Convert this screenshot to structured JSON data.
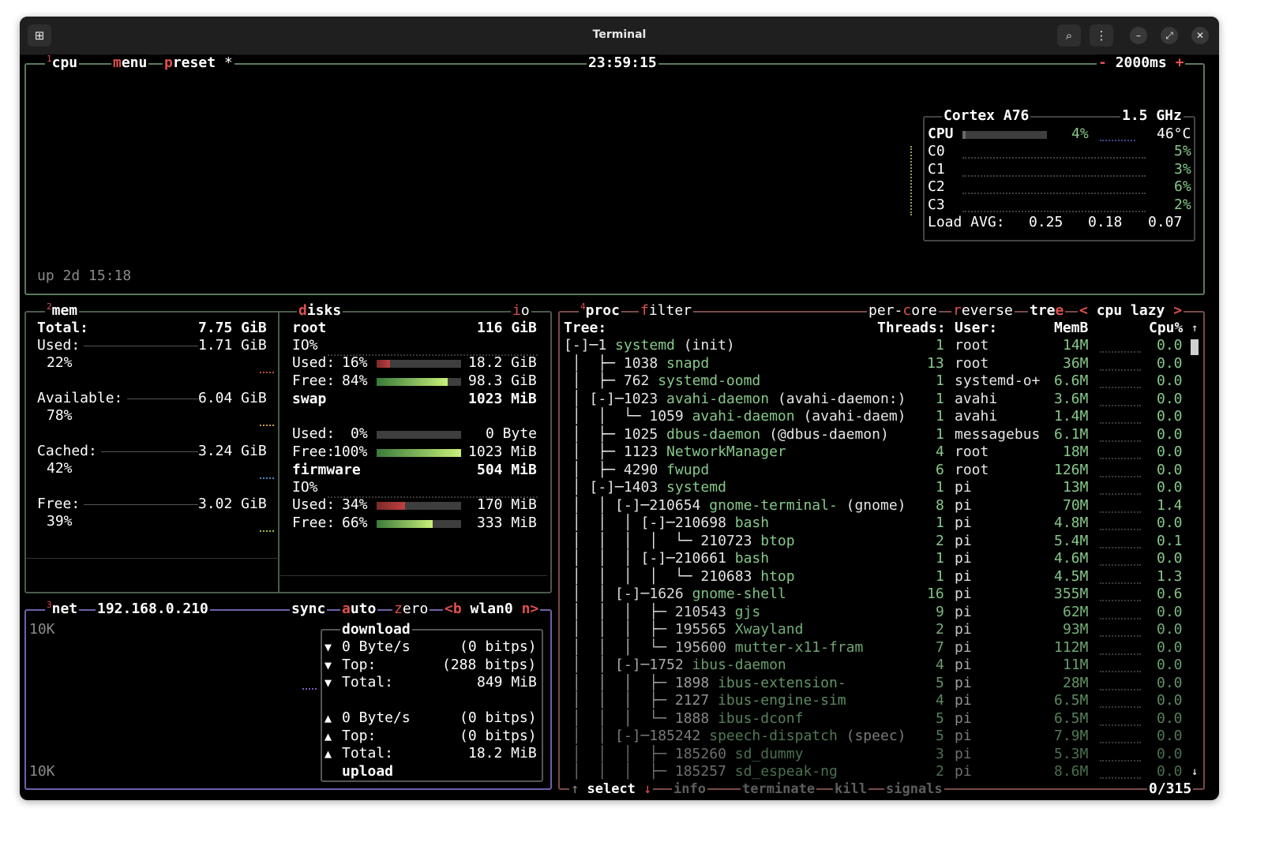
{
  "window": {
    "title": "Terminal"
  },
  "cpu": {
    "num": "1",
    "label": "cpu",
    "menu": "menu",
    "preset": "preset",
    "preset_star": "*",
    "clock": "23:59:15",
    "interval_minus": "-",
    "interval": "2000ms",
    "interval_plus": "+",
    "model": "Cortex A76",
    "freq": "1.5 GHz",
    "total_label": "CPU",
    "total_pct": "4%",
    "temp": "46°C",
    "total_fill": 0.04,
    "cores": [
      {
        "name": "C0",
        "pct": "5%"
      },
      {
        "name": "C1",
        "pct": "3%"
      },
      {
        "name": "C2",
        "pct": "6%"
      },
      {
        "name": "C3",
        "pct": "2%"
      }
    ],
    "load_label": "Load AVG:",
    "load": [
      "0.25",
      "0.18",
      "0.07"
    ],
    "uptime": "up 2d 15:18"
  },
  "mem": {
    "num": "2",
    "label": "mem",
    "total_label": "Total:",
    "total": "7.75 GiB",
    "rows": [
      {
        "label": "Used:",
        "value": "1.71 GiB",
        "pct": "22%"
      },
      {
        "label": "Available:",
        "value": "6.04 GiB",
        "pct": "78%"
      },
      {
        "label": "Cached:",
        "value": "3.24 GiB",
        "pct": "42%"
      },
      {
        "label": "Free:",
        "value": "3.02 GiB",
        "pct": "39%"
      }
    ]
  },
  "disks": {
    "label": "disks",
    "io": "io",
    "items": [
      {
        "name": "root",
        "size": "116 GiB",
        "io": "IO%",
        "used_label": "Used:",
        "used_pct": "16%",
        "used": "18.2 GiB",
        "used_fill": 0.16,
        "free_label": "Free:",
        "free_pct": "84%",
        "free": "98.3 GiB",
        "free_fill": 0.84
      },
      {
        "name": "swap",
        "size": "1023 MiB",
        "io": "",
        "used_label": "Used:",
        "used_pct": "0%",
        "used": "0 Byte",
        "used_fill": 0.0,
        "free_label": "Free:",
        "free_pct": "100%",
        "free": "1023 MiB",
        "free_fill": 1.0
      },
      {
        "name": "firmware",
        "size": "504 MiB",
        "io": "IO%",
        "used_label": "Used:",
        "used_pct": "34%",
        "used": "170 MiB",
        "used_fill": 0.34,
        "free_label": "Free:",
        "free_pct": "66%",
        "free": "333 MiB",
        "free_fill": 0.66
      }
    ]
  },
  "net": {
    "num": "3",
    "label": "net",
    "ip": "192.168.0.210",
    "sync": "sync",
    "auto": "auto",
    "zero": "zero",
    "prev": "<b",
    "iface": "wlan0",
    "next": "n>",
    "scale_top": "10K",
    "scale_bottom": "10K",
    "download_label": "download",
    "upload_label": "upload",
    "down": [
      {
        "icon": "▼",
        "label": "0 Byte/s",
        "value": "(0 bitps)"
      },
      {
        "icon": "▼",
        "label": "Top:",
        "value": "(288 bitps)"
      },
      {
        "icon": "▼",
        "label": "Total:",
        "value": "849 MiB"
      }
    ],
    "up": [
      {
        "icon": "▲",
        "label": "0 Byte/s",
        "value": "(0 bitps)"
      },
      {
        "icon": "▲",
        "label": "Top:",
        "value": "(0 bitps)"
      },
      {
        "icon": "▲",
        "label": "Total:",
        "value": "18.2 MiB"
      }
    ]
  },
  "proc": {
    "num": "4",
    "label": "proc",
    "filter": "filter",
    "per_core": "per-core",
    "reverse": "reverse",
    "tree": "tree",
    "sort_prev": "<",
    "sort": "cpu lazy",
    "sort_next": ">",
    "headers": {
      "tree": "Tree:",
      "threads": "Threads:",
      "user": "User:",
      "mem": "MemB",
      "cpu": "Cpu%"
    },
    "rows": [
      {
        "tree": "[-]─1 ",
        "name": "systemd",
        "args": " (init)",
        "threads": "1",
        "user": "root",
        "mem": "14M",
        "cpu": "0.0"
      },
      {
        "tree": " │  ├─ 1038 ",
        "name": "snapd",
        "args": "",
        "threads": "13",
        "user": "root",
        "mem": "36M",
        "cpu": "0.0"
      },
      {
        "tree": " │  ├─ 762 ",
        "name": "systemd-oomd",
        "args": "",
        "threads": "1",
        "user": "systemd-o+",
        "mem": "6.6M",
        "cpu": "0.0"
      },
      {
        "tree": " │ [-]─1023 ",
        "name": "avahi-daemon",
        "args": " (avahi-daemon:)",
        "threads": "1",
        "user": "avahi",
        "mem": "3.6M",
        "cpu": "0.0"
      },
      {
        "tree": " │  │  └─ 1059 ",
        "name": "avahi-daemon",
        "args": " (avahi-daem)",
        "threads": "1",
        "user": "avahi",
        "mem": "1.4M",
        "cpu": "0.0"
      },
      {
        "tree": " │  ├─ 1025 ",
        "name": "dbus-daemon",
        "args": " (@dbus-daemon)",
        "threads": "1",
        "user": "messagebus",
        "mem": "6.1M",
        "cpu": "0.0"
      },
      {
        "tree": " │  ├─ 1123 ",
        "name": "NetworkManager",
        "args": "",
        "threads": "4",
        "user": "root",
        "mem": "18M",
        "cpu": "0.0"
      },
      {
        "tree": " │  ├─ 4290 ",
        "name": "fwupd",
        "args": "",
        "threads": "6",
        "user": "root",
        "mem": "126M",
        "cpu": "0.0"
      },
      {
        "tree": " │ [-]─1403 ",
        "name": "systemd",
        "args": "",
        "threads": "1",
        "user": "pi",
        "mem": "13M",
        "cpu": "0.0"
      },
      {
        "tree": " │  │ [-]─210654 ",
        "name": "gnome-terminal-",
        "args": " (gnome)",
        "threads": "8",
        "user": "pi",
        "mem": "70M",
        "cpu": "1.4"
      },
      {
        "tree": " │  │  │ [-]─210698 ",
        "name": "bash",
        "args": "",
        "threads": "1",
        "user": "pi",
        "mem": "4.8M",
        "cpu": "0.0"
      },
      {
        "tree": " │  │  │  │  └─ 210723 ",
        "name": "btop",
        "args": "",
        "threads": "2",
        "user": "pi",
        "mem": "5.4M",
        "cpu": "0.1"
      },
      {
        "tree": " │  │  │ [-]─210661 ",
        "name": "bash",
        "args": "",
        "threads": "1",
        "user": "pi",
        "mem": "4.6M",
        "cpu": "0.0"
      },
      {
        "tree": " │  │  │  │  └─ 210683 ",
        "name": "htop",
        "args": "",
        "threads": "1",
        "user": "pi",
        "mem": "4.5M",
        "cpu": "1.3"
      },
      {
        "tree": " │  │ [-]─1626 ",
        "name": "gnome-shell",
        "args": "",
        "threads": "16",
        "user": "pi",
        "mem": "355M",
        "cpu": "0.6"
      },
      {
        "tree": " │  │  │  ├─ 210543 ",
        "name": "gjs",
        "args": "",
        "threads": "9",
        "user": "pi",
        "mem": "62M",
        "cpu": "0.0"
      },
      {
        "tree": " │  │  │  ├─ 195565 ",
        "name": "Xwayland",
        "args": "",
        "threads": "2",
        "user": "pi",
        "mem": "93M",
        "cpu": "0.0"
      },
      {
        "tree": " │  │  │  └─ 195600 ",
        "name": "mutter-x11-fram",
        "args": "",
        "threads": "7",
        "user": "pi",
        "mem": "112M",
        "cpu": "0.0"
      },
      {
        "tree": " │  │ [-]─1752 ",
        "name": "ibus-daemon",
        "args": "",
        "threads": "4",
        "user": "pi",
        "mem": "11M",
        "cpu": "0.0"
      },
      {
        "tree": " │  │  │  ├─ 1898 ",
        "name": "ibus-extension-",
        "args": "",
        "threads": "5",
        "user": "pi",
        "mem": "28M",
        "cpu": "0.0"
      },
      {
        "tree": " │  │  │  ├─ 2127 ",
        "name": "ibus-engine-sim",
        "args": "",
        "threads": "4",
        "user": "pi",
        "mem": "6.5M",
        "cpu": "0.0"
      },
      {
        "tree": " │  │  │  └─ 1888 ",
        "name": "ibus-dconf",
        "args": "",
        "threads": "5",
        "user": "pi",
        "mem": "6.5M",
        "cpu": "0.0"
      },
      {
        "tree": " │  │ [-]─185242 ",
        "name": "speech-dispatch",
        "args": " (speec)",
        "threads": "5",
        "user": "pi",
        "mem": "7.9M",
        "cpu": "0.0"
      },
      {
        "tree": " │  │  │  ├─ 185260 ",
        "name": "sd_dummy",
        "args": "",
        "threads": "3",
        "user": "pi",
        "mem": "5.3M",
        "cpu": "0.0"
      },
      {
        "tree": " │  │  │  ├─ 185257 ",
        "name": "sd_espeak-ng",
        "args": "",
        "threads": "2",
        "user": "pi",
        "mem": "8.6M",
        "cpu": "0.0"
      }
    ],
    "footer": {
      "select_up": "↑",
      "select": "select",
      "select_down": "↓",
      "info": "info",
      "terminate": "terminate",
      "kill": "kill",
      "signals": "signals",
      "count": "0/315"
    },
    "scroll_up": "↑",
    "scroll_down": "↓"
  }
}
